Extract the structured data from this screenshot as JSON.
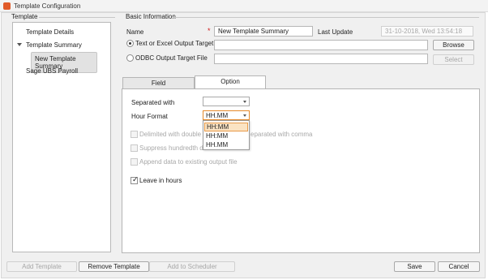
{
  "window": {
    "title": "Template Configuration"
  },
  "template_panel": {
    "label": "Template",
    "items": [
      {
        "label": "Template Details"
      },
      {
        "label": "Template Summary"
      },
      {
        "label": "New Template Summary"
      },
      {
        "label": "Sage UBS Payroll"
      }
    ]
  },
  "basic_info": {
    "label": "Basic Information",
    "name_label": "Name",
    "required_mark": "*",
    "name_value": "New Template Summary",
    "last_update_label": "Last Update",
    "last_update_value": "31-10-2018, Wed  13:54:18",
    "radio_text_excel": "Text or Excel Output Target File",
    "radio_odbc": "ODBC Output Target File",
    "text_excel_value": "",
    "odbc_value": "",
    "browse_label": "Browse",
    "select_label": "Select"
  },
  "tabs": [
    {
      "label": "Field"
    },
    {
      "label": "Option"
    }
  ],
  "options": {
    "separated_with_label": "Separated with",
    "separated_with_value": "",
    "hour_format_label": "Hour Format",
    "hour_format_value": "HH.MM",
    "hour_format_options": [
      "HH:MM",
      "HH:MM",
      "HH.MM"
    ],
    "delimited_text": "Delimited with double quo",
    "delimited_suffix": "eparated with comma",
    "suppress_text": "Suppress hundredth deci",
    "append_text": "Append data to existing output file",
    "leave_in_hours_text": "Leave in hours",
    "leave_in_hours_checked": true
  },
  "footer": {
    "add_template": "Add Template",
    "remove_template": "Remove Template",
    "add_scheduler": "Add to Scheduler",
    "save": "Save",
    "cancel": "Cancel"
  }
}
